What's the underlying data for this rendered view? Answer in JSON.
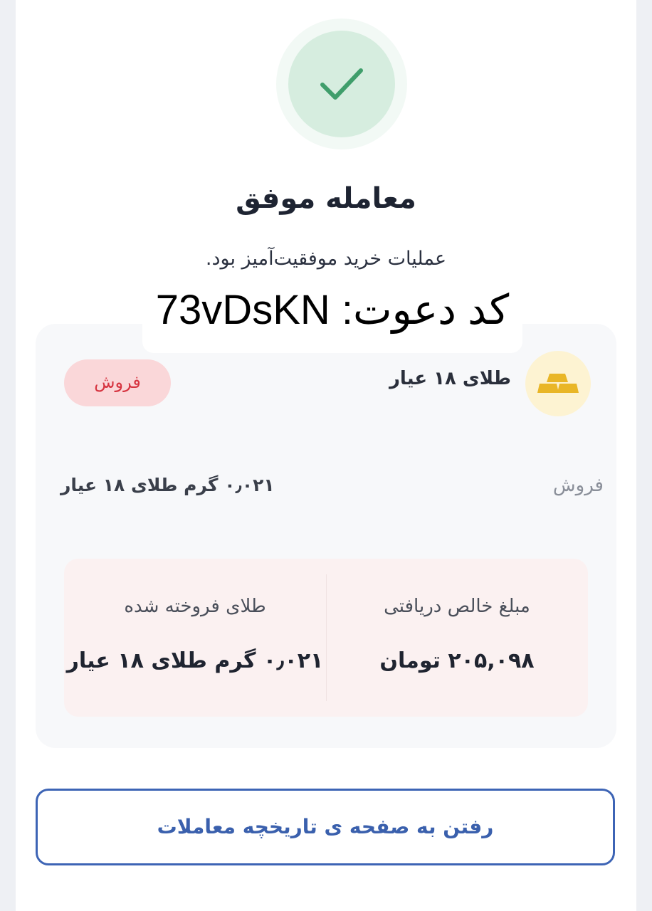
{
  "status": {
    "icon": "check-icon",
    "title": "معامله موفق",
    "subtitle": "عملیات خرید موفقیت‌آمیز بود."
  },
  "invite": {
    "label": "کد دعوت: 73vDsKN"
  },
  "trade": {
    "asset_icon": "gold-bars-icon",
    "asset_name": "طلای ۱۸ عیار",
    "type_badge": "فروش",
    "type_label": "فروش",
    "amount": "۰٫۰۲۱  گرم طلای ۱۸ عیار"
  },
  "summary": {
    "net_received_label": "مبلغ خالص دریافتی",
    "net_received_value": "۲۰۵,۰۹۸  تومان",
    "gold_sold_label": "طلای فروخته شده",
    "gold_sold_value": "۰٫۰۲۱  گرم طلای ۱۸ عیار"
  },
  "actions": {
    "history_button": "رفتن به صفحه ی تاریخچه معاملات"
  },
  "colors": {
    "success_green": "#3f9e6b",
    "sell_red": "#d63440",
    "primary_blue": "#3d64b5",
    "gold": "#e9b627"
  }
}
